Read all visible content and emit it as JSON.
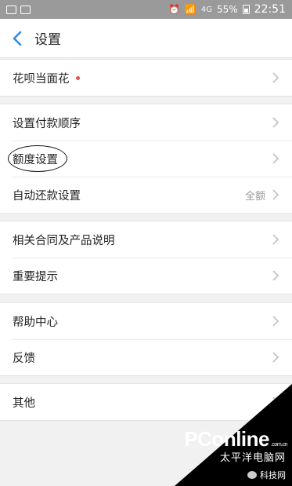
{
  "status_bar": {
    "network": "4G",
    "battery": "55%",
    "time": "22:51"
  },
  "header": {
    "title": "设置"
  },
  "groups": [
    {
      "rows": [
        {
          "label": "花呗当面花",
          "has_red_dot": true
        }
      ]
    },
    {
      "rows": [
        {
          "label": "设置付款顺序"
        },
        {
          "label": "额度设置",
          "circled": true
        },
        {
          "label": "自动还款设置",
          "value": "全额"
        }
      ]
    },
    {
      "rows": [
        {
          "label": "相关合同及产品说明"
        },
        {
          "label": "重要提示"
        }
      ]
    },
    {
      "rows": [
        {
          "label": "帮助中心"
        },
        {
          "label": "反馈"
        }
      ]
    },
    {
      "rows": [
        {
          "label": "其他"
        }
      ]
    }
  ],
  "watermark": {
    "logo": "PConline",
    "domain": ".com.cn",
    "cn": "太平洋电脑网",
    "badge": "科技网"
  },
  "colors": {
    "accent": "#2f8de4",
    "red_dot": "#e8504a",
    "chevron": "#c4c4c4"
  }
}
